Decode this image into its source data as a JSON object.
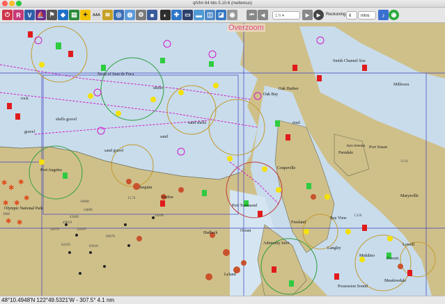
{
  "window": {
    "title": "qtVlm 64 bits 5.10-6 (meltemus)"
  },
  "toolbar": {
    "time_step_value": "1 h",
    "reckoning_label": "Reckoning",
    "reckoning_value": "6",
    "reckoning_unit": "mins",
    "icons": [
      "quit-icon",
      "route-icon",
      "vlm-icon",
      "boat-icon",
      "flag-icon",
      "poi-icon",
      "folder-icon",
      "grib-icon",
      "barb-icon",
      "zoom-icon",
      "bulb-icon",
      "scale-icon",
      "chart-icon",
      "orbit-icon",
      "settings-icon",
      "square-icon",
      "globe-icon",
      "screen-icon",
      "camera-icon",
      "history-icon",
      "time-icon",
      "play-icon",
      "bell-icon",
      "target-icon"
    ],
    "scale_label": "AAA"
  },
  "map": {
    "overzoom_label": "Overzoom",
    "places": [
      "Port Angeles",
      "Sequim",
      "Olympic National Park",
      "Harbor",
      "Port Townsend",
      "Oak Bay",
      "Hadlock",
      "Coupeville",
      "Oak Harbor",
      "Bay View",
      "Freeland",
      "Langley",
      "Everett",
      "Mukilteo",
      "Marysville",
      "Lowell",
      "Meadowdale",
      "Leland",
      "Ocean",
      "Ferndale"
    ],
    "water_labels": [
      "Smith Channel Sou",
      "Strait of Juan de Fuca",
      "Admiralty Inlet",
      "Port Susan",
      "Possession Sound"
    ],
    "depths": [
      "1600ft",
      "4300ft",
      "3591ft",
      "4981ft",
      "3480ft",
      "5097ft",
      "6245ft",
      "8361ft",
      "6007ft",
      "2000",
      "15.76",
      "15.61",
      "2420ft",
      "1.250"
    ],
    "misc_labels": [
      "rock",
      "sand",
      "gravel",
      "shells",
      "mud",
      "sand shells",
      "shells gravel",
      "sand gravel",
      "two towers",
      "Milltown"
    ]
  },
  "status": {
    "coordinates": "48°10.4948'N 122°49.5321'W - 307.5° 4.1 nm"
  }
}
